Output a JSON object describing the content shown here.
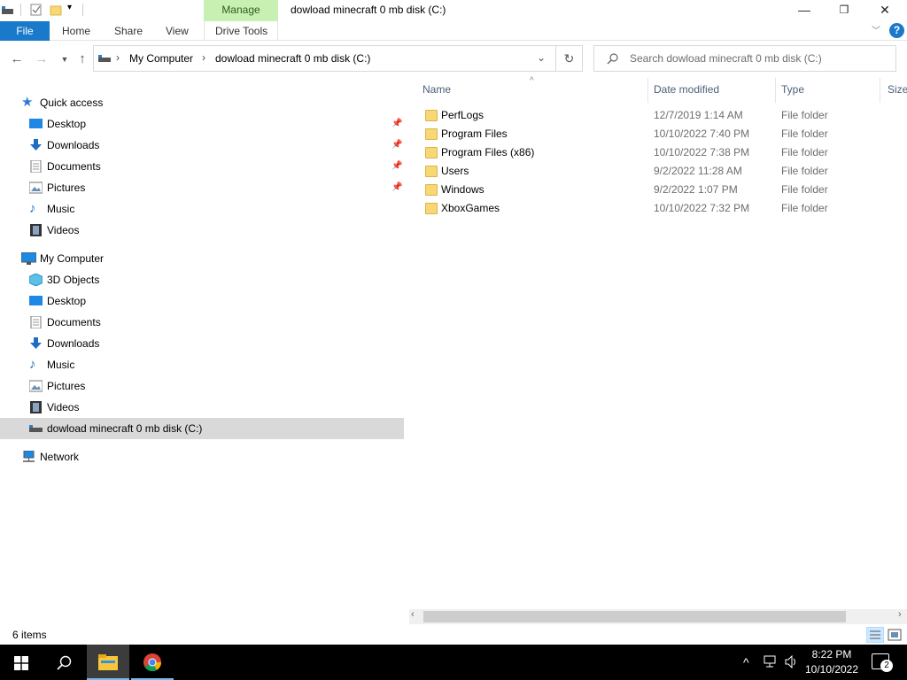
{
  "window": {
    "title": "dowload minecraft 0 mb disk (C:)",
    "manage_tab": "Manage",
    "minimize": "—",
    "restore": "❐",
    "close": "✕"
  },
  "ribbon": {
    "tabs": [
      "File",
      "Home",
      "Share",
      "View",
      "Drive Tools"
    ],
    "help": "?"
  },
  "address": {
    "crumbs": [
      "My Computer",
      "dowload minecraft 0 mb disk (C:)"
    ],
    "search_placeholder": "Search dowload minecraft 0 mb disk (C:)"
  },
  "nav_pane": {
    "quick_access": {
      "label": "Quick access",
      "items": [
        {
          "label": "Desktop",
          "icon": "desktop-icon",
          "pinned": true
        },
        {
          "label": "Downloads",
          "icon": "downloads-icon",
          "pinned": true
        },
        {
          "label": "Documents",
          "icon": "documents-icon",
          "pinned": true
        },
        {
          "label": "Pictures",
          "icon": "pictures-icon",
          "pinned": true
        },
        {
          "label": "Music",
          "icon": "music-icon",
          "pinned": false
        },
        {
          "label": "Videos",
          "icon": "videos-icon",
          "pinned": false
        }
      ]
    },
    "my_computer": {
      "label": "My Computer",
      "items": [
        {
          "label": "3D Objects",
          "icon": "3d-objects-icon"
        },
        {
          "label": "Desktop",
          "icon": "desktop-icon"
        },
        {
          "label": "Documents",
          "icon": "documents-icon"
        },
        {
          "label": "Downloads",
          "icon": "downloads-icon"
        },
        {
          "label": "Music",
          "icon": "music-icon"
        },
        {
          "label": "Pictures",
          "icon": "pictures-icon"
        },
        {
          "label": "Videos",
          "icon": "videos-icon"
        },
        {
          "label": "dowload minecraft 0 mb disk (C:)",
          "icon": "drive-icon",
          "selected": true
        }
      ]
    },
    "network": {
      "label": "Network"
    }
  },
  "file_list": {
    "columns": [
      "Name",
      "Date modified",
      "Type",
      "Size"
    ],
    "rows": [
      {
        "name": "PerfLogs",
        "date": "12/7/2019 1:14 AM",
        "type": "File folder"
      },
      {
        "name": "Program Files",
        "date": "10/10/2022 7:40 PM",
        "type": "File folder"
      },
      {
        "name": "Program Files (x86)",
        "date": "10/10/2022 7:38 PM",
        "type": "File folder"
      },
      {
        "name": "Users",
        "date": "9/2/2022 11:28 AM",
        "type": "File folder"
      },
      {
        "name": "Windows",
        "date": "9/2/2022 1:07 PM",
        "type": "File folder"
      },
      {
        "name": "XboxGames",
        "date": "10/10/2022 7:32 PM",
        "type": "File folder"
      }
    ]
  },
  "status": {
    "items_count": "6 items"
  },
  "taskbar": {
    "time": "8:22 PM",
    "date": "10/10/2022",
    "notification_count": "2"
  },
  "colors": {
    "file_tab": "#1979ca",
    "manage_tab": "#c9f0b3",
    "folder": "#f8d775",
    "selection": "#d9d9d9",
    "header_text": "#4c607a"
  }
}
